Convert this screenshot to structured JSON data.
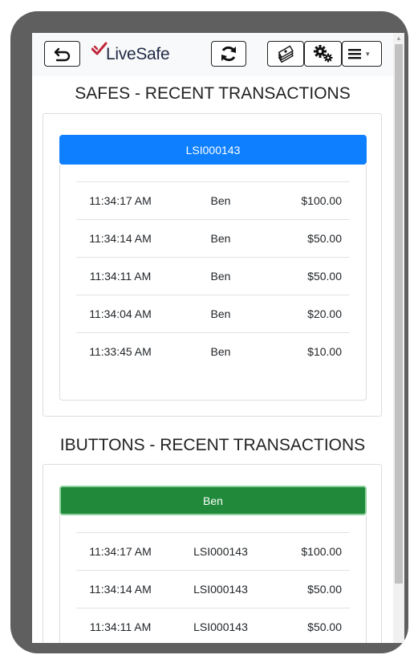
{
  "app": {
    "brand": "LiveSafe"
  },
  "toolbar": {
    "menu_caret": "▾"
  },
  "safes": {
    "title": "SAFES - RECENT TRANSACTIONS",
    "group": "LSI000143",
    "rows": [
      {
        "time": "11:34:17 AM",
        "name": "Ben",
        "amount": "$100.00"
      },
      {
        "time": "11:34:14 AM",
        "name": "Ben",
        "amount": "$50.00"
      },
      {
        "time": "11:34:11 AM",
        "name": "Ben",
        "amount": "$50.00"
      },
      {
        "time": "11:34:04 AM",
        "name": "Ben",
        "amount": "$20.00"
      },
      {
        "time": "11:33:45 AM",
        "name": "Ben",
        "amount": "$10.00"
      }
    ]
  },
  "ibuttons": {
    "title": "IBUTTONS - RECENT TRANSACTIONS",
    "group": "Ben",
    "rows": [
      {
        "time": "11:34:17 AM",
        "name": "LSI000143",
        "amount": "$100.00"
      },
      {
        "time": "11:34:14 AM",
        "name": "LSI000143",
        "amount": "$50.00"
      },
      {
        "time": "11:34:11 AM",
        "name": "LSI000143",
        "amount": "$50.00"
      }
    ]
  },
  "colors": {
    "safe_header": "#0d7fff",
    "ibutton_header": "#208a3a"
  },
  "icons": [
    "back-arrow-icon",
    "checkmark-logo-icon",
    "refresh-icon",
    "money-stack-icon",
    "gears-icon",
    "hamburger-menu-icon"
  ]
}
